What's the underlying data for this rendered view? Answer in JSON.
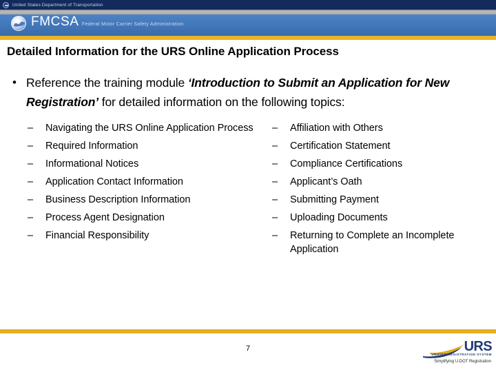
{
  "header": {
    "dot_banner": "United States Department of Transportation",
    "dot_seal_icon": "dot-seal-icon",
    "agency_abbr": "FMCSA",
    "agency_full": "Federal Motor Carrier Safety Administration",
    "agency_seal_icon": "fmcsa-seal-icon",
    "colors": {
      "navy": "#132a5c",
      "blue": "#4176b8",
      "gold": "#e8b622",
      "gray": "#bdbdbf"
    }
  },
  "slide": {
    "title": "Detailed Information for the URS Online Application Process",
    "lead": {
      "bullet_glyph": "•",
      "part1": "Reference the training module ",
      "emphasis": "‘Introduction to Submit an Application for New Registration’",
      "part2": " for detailed information on the following topics:"
    },
    "dash_glyph": "–",
    "left_column": [
      "Navigating the URS Online Application Process",
      "Required Information",
      "Informational Notices",
      "Application Contact Information",
      "Business Description Information",
      "Process Agent Designation",
      "Financial Responsibility"
    ],
    "right_column": [
      "Affiliation with Others",
      "Certification Statement",
      "Compliance Certifications",
      "Applicant’s Oath",
      "Submitting Payment",
      "Uploading Documents",
      "Returning to Complete an Incomplete Application"
    ]
  },
  "footer": {
    "page_number": "7",
    "urs_word": "URS",
    "urs_subtitle": "UNIFIED REGISTRATION SYSTEM",
    "urs_tagline": "Simplifying U.DOT Registration",
    "urs_logo_icon": "urs-swoosh-icon",
    "rule_color": "#e3b01f"
  }
}
